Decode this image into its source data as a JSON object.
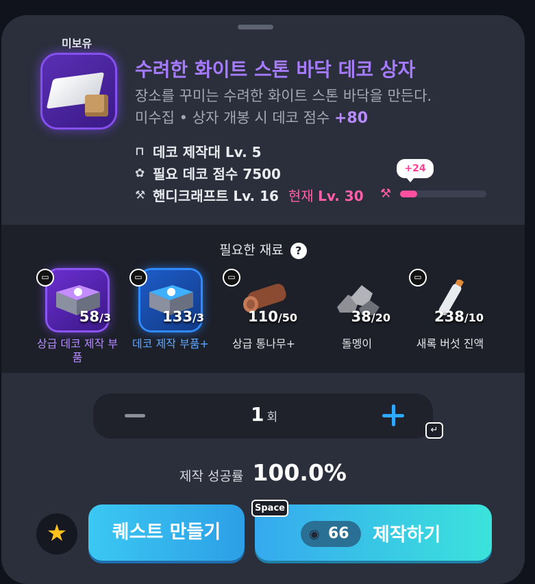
{
  "item": {
    "owned_status": "미보유",
    "name": "수려한 화이트 스톤 바닥 데코 상자",
    "description": "장소를 꾸미는 수려한 화이트 스톤 바닥을 만든다.",
    "collect_text": "미수집 • 상자 개봉 시 데코 점수",
    "score_bonus": "+80"
  },
  "requirements": {
    "workbench": "데코 제작대 Lv. 5",
    "deco_score": "필요 데코 점수 7500",
    "craft_skill": "핸디크래프트 Lv. 16",
    "current_label": "현재",
    "current_level": "Lv. 30"
  },
  "progress": {
    "bubble": "+24",
    "fill_fraction": 0.2
  },
  "materials": {
    "title": "필요한 재료",
    "help_icon": "?",
    "items": [
      {
        "owned": "58",
        "required": "/3",
        "label": "상급 데코 제작 부품",
        "color": "#b48cff"
      },
      {
        "owned": "133",
        "required": "/3",
        "label": "데코 제작 부품+",
        "color": "#5da8ff"
      },
      {
        "owned": "110",
        "required": "/50",
        "label": "상급 통나무+",
        "color": "#e2e4e8"
      },
      {
        "owned": "38",
        "required": "/20",
        "label": "돌멩이",
        "color": "#e2e4e8"
      },
      {
        "owned": "238",
        "required": "/10",
        "label": "새록 버섯 진액",
        "color": "#e2e4e8"
      }
    ]
  },
  "quantity": {
    "value": "1",
    "unit": "회"
  },
  "success_rate": {
    "label": "제작 성공률",
    "value": "100.0%"
  },
  "buttons": {
    "quest": "퀘스트 만들기",
    "craft": "제작하기",
    "craft_cost": "66",
    "space_hint": "Space"
  },
  "icons": [
    "star-icon",
    "minus-icon",
    "plus-icon",
    "enter-key-icon",
    "workbench-icon",
    "leaf-icon",
    "hammer-icon",
    "storage-bin-icon",
    "help-icon"
  ]
}
